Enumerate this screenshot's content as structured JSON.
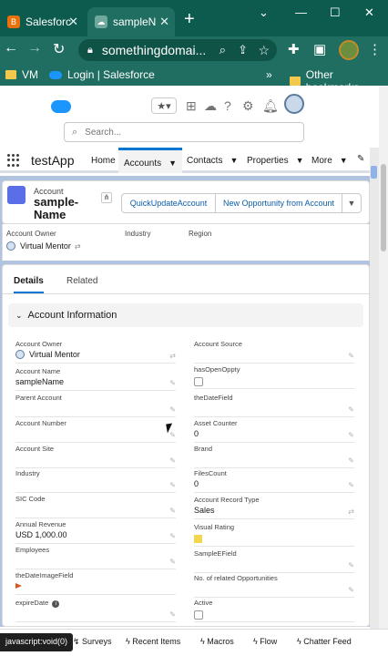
{
  "browser": {
    "tabs": [
      {
        "label": "Salesforc",
        "active": false
      },
      {
        "label": "sampleN",
        "active": true
      }
    ],
    "url": "somethingdomai...",
    "bookmarks": [
      "VM",
      "Login | Salesforce",
      "Other bookmarks"
    ],
    "more_bookmarks": "»"
  },
  "header": {
    "search_placeholder": "Search..."
  },
  "appnav": {
    "app_name": "testApp",
    "items": [
      {
        "label": "Home"
      },
      {
        "label": "Accounts",
        "active": true
      },
      {
        "label": "Contacts"
      },
      {
        "label": "Properties"
      },
      {
        "label": "More"
      }
    ]
  },
  "record": {
    "type_label": "Account",
    "name": "sample-Name",
    "actions": [
      "QuickUpdateAccount",
      "New Opportunity from Account"
    ],
    "highlights": [
      {
        "label": "Account Owner",
        "value": "Virtual Mentor"
      },
      {
        "label": "Industry",
        "value": ""
      },
      {
        "label": "Region",
        "value": ""
      }
    ]
  },
  "detail": {
    "tabs": [
      "Details",
      "Related"
    ],
    "section_title": "Account Information",
    "left_fields": [
      {
        "label": "Account Owner",
        "value": "Virtual Mentor"
      },
      {
        "label": "Account Name",
        "value": "sampleName"
      },
      {
        "label": "Parent Account",
        "value": ""
      },
      {
        "label": "Account Number",
        "value": ""
      },
      {
        "label": "Account Site",
        "value": ""
      },
      {
        "label": "Industry",
        "value": ""
      },
      {
        "label": "SIC Code",
        "value": ""
      },
      {
        "label": "Annual Revenue",
        "value": "USD 1,000.00"
      },
      {
        "label": "Employees",
        "value": ""
      },
      {
        "label": "theDateImageField",
        "value": ""
      },
      {
        "label": "expireDate",
        "value": ""
      }
    ],
    "right_fields": [
      {
        "label": "Account Source",
        "value": ""
      },
      {
        "label": "hasOpenOppty",
        "value": ""
      },
      {
        "label": "theDateField",
        "value": ""
      },
      {
        "label": "Asset Counter",
        "value": "0"
      },
      {
        "label": "Brand",
        "value": ""
      },
      {
        "label": "FilesCount",
        "value": "0"
      },
      {
        "label": "Account Record Type",
        "value": "Sales"
      },
      {
        "label": "Visual Rating",
        "value": ""
      },
      {
        "label": "SampleEField",
        "value": ""
      },
      {
        "label": "No. of related Opportunities",
        "value": ""
      },
      {
        "label": "Active",
        "value": ""
      }
    ]
  },
  "utility_bar": [
    "Surveys",
    "Recent Items",
    "Macros",
    "Flow",
    "Chatter Feed"
  ],
  "status_text": "javascript:void(0)",
  "colors": {
    "tab_bg": "#0d5b4f",
    "toolbar_bg": "#1f6e61",
    "brand_blue": "#0176d3",
    "page_bg": "#b0c4df"
  }
}
